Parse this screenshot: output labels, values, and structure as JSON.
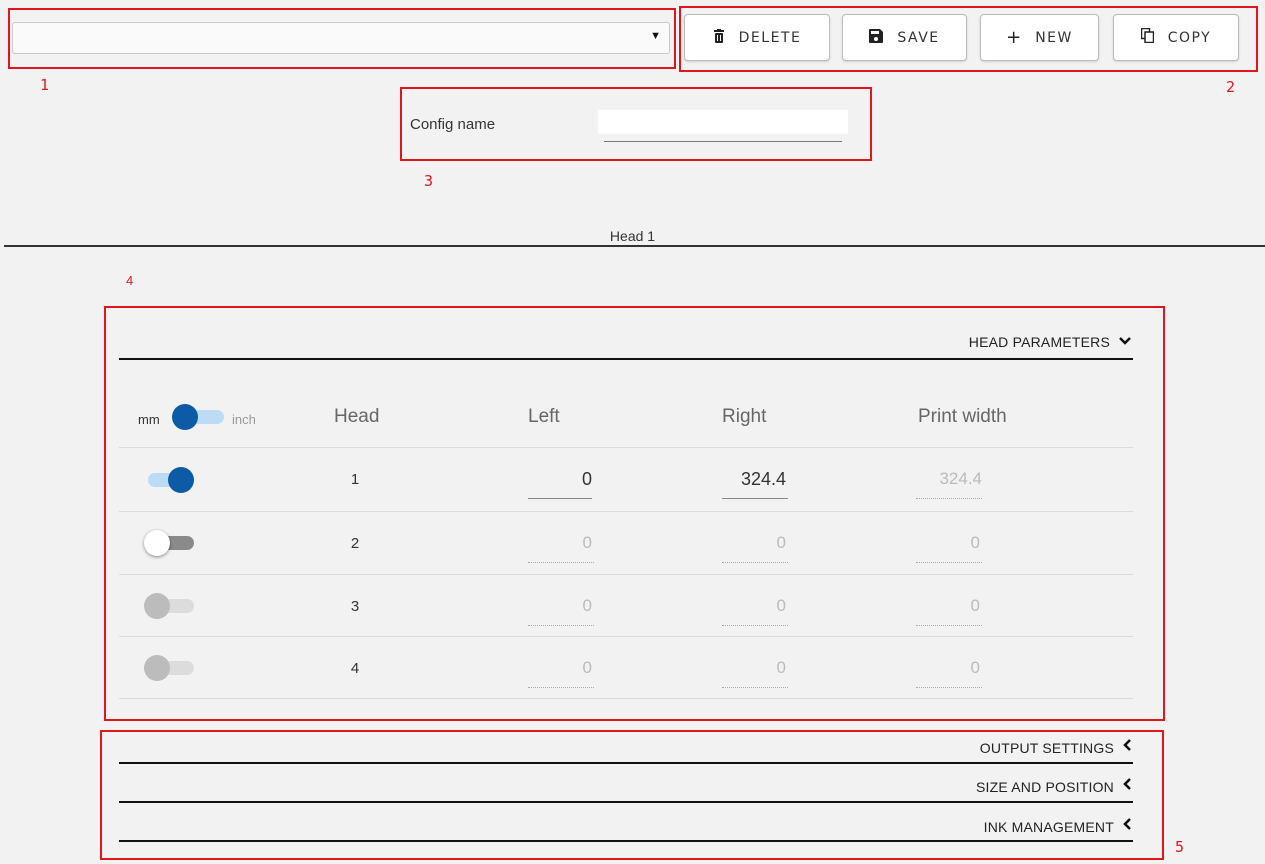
{
  "annotations": {
    "a1": "1",
    "a2": "2",
    "a3": "3",
    "a4": "4",
    "a5": "5"
  },
  "config_select": {
    "value": "",
    "arrow": "▼"
  },
  "toolbar": {
    "delete_label": "DELETE",
    "save_label": "SAVE",
    "new_label": "NEW",
    "copy_label": "COPY",
    "delete_icon": "trash-icon",
    "save_icon": "floppy-icon",
    "new_icon": "plus-icon",
    "copy_icon": "copy-icon"
  },
  "config_name": {
    "label": "Config name",
    "value": ""
  },
  "tabs": {
    "head1": "Head 1"
  },
  "head_parameters": {
    "title": "HEAD PARAMETERS",
    "expanded": true,
    "units": {
      "left": "mm",
      "right": "inch",
      "selected": "mm"
    },
    "columns": {
      "head": "Head",
      "left": "Left",
      "right": "Right",
      "print_width": "Print width"
    },
    "rows": [
      {
        "enabled": true,
        "head": "1",
        "left": "0",
        "right": "324.4",
        "print_width": "324.4"
      },
      {
        "enabled": false,
        "head": "2",
        "left": "0",
        "right": "0",
        "print_width": "0"
      },
      {
        "enabled": false,
        "head": "3",
        "left": "0",
        "right": "0",
        "print_width": "0"
      },
      {
        "enabled": false,
        "head": "4",
        "left": "0",
        "right": "0",
        "print_width": "0"
      }
    ]
  },
  "sections": {
    "output_settings": "OUTPUT SETTINGS",
    "size_and_position": "SIZE AND POSITION",
    "ink_management": "INK MANAGEMENT"
  },
  "colors": {
    "accent": "#0d5aa7",
    "annotation": "#e0161e"
  }
}
